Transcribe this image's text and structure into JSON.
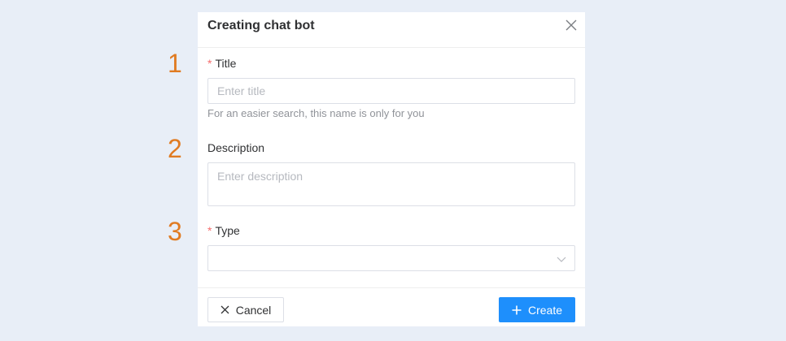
{
  "steps": [
    "1",
    "2",
    "3"
  ],
  "modal": {
    "title": "Creating chat bot",
    "close_icon": "close-icon"
  },
  "form": {
    "title": {
      "required_mark": "*",
      "label": "Title",
      "placeholder": "Enter title",
      "value": "",
      "hint": "For an easier search, this name is only for you"
    },
    "description": {
      "label": "Description",
      "placeholder": "Enter description",
      "value": ""
    },
    "type": {
      "required_mark": "*",
      "label": "Type",
      "selected": "",
      "arrow_icon": "chevron-down-icon"
    }
  },
  "footer": {
    "cancel_label": "Cancel",
    "cancel_icon": "close-icon",
    "create_label": "Create",
    "create_icon": "plus-icon"
  },
  "colors": {
    "background": "#e8eef7",
    "step_number": "#e07b22",
    "required": "#f56c6c",
    "primary": "#1e8ffc"
  }
}
